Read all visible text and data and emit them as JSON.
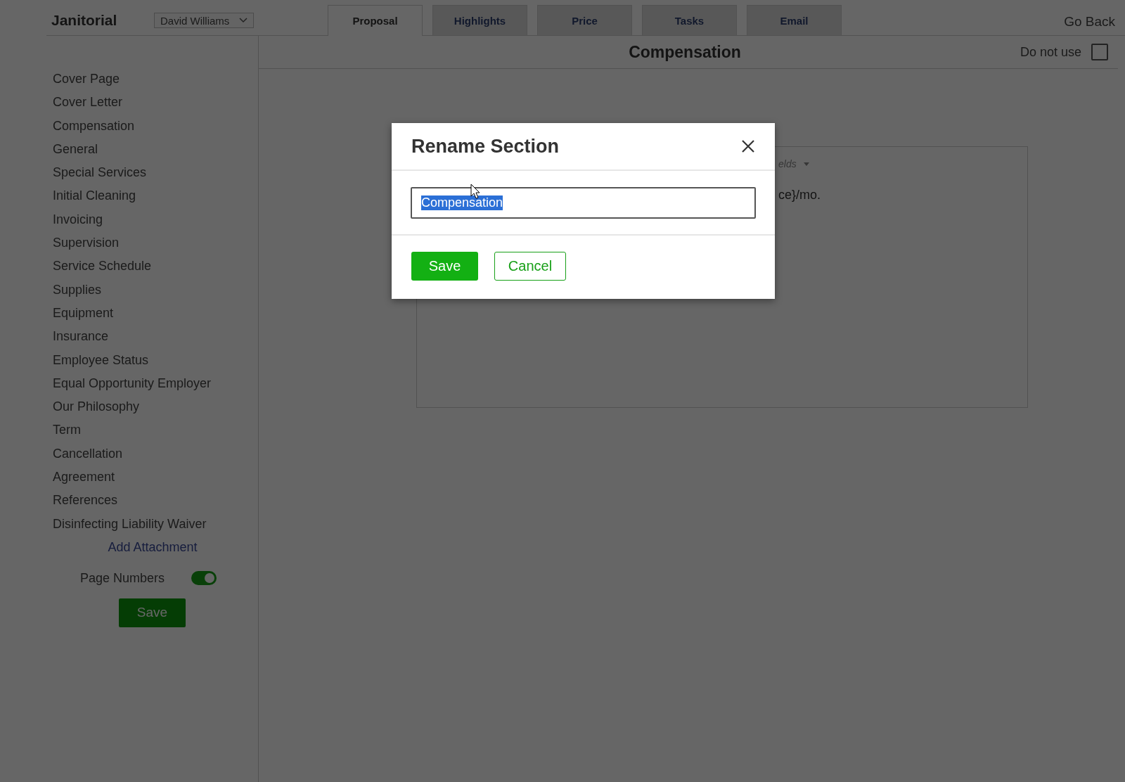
{
  "header": {
    "title": "Janitorial",
    "user_select": "David Williams",
    "go_back": "Go Back"
  },
  "tabs": [
    {
      "label": "Proposal",
      "selected": true
    },
    {
      "label": "Highlights",
      "selected": false
    },
    {
      "label": "Price",
      "selected": false
    },
    {
      "label": "Tasks",
      "selected": false
    },
    {
      "label": "Email",
      "selected": false
    }
  ],
  "sidebar": {
    "items": [
      {
        "label": "Cover Page"
      },
      {
        "label": "Cover Letter"
      },
      {
        "label": "Compensation"
      },
      {
        "label": "General"
      },
      {
        "label": "Special Services"
      },
      {
        "label": "Initial Cleaning"
      },
      {
        "label": "Invoicing"
      },
      {
        "label": "Supervision"
      },
      {
        "label": "Service Schedule"
      },
      {
        "label": "Supplies"
      },
      {
        "label": "Equipment"
      },
      {
        "label": "Insurance"
      },
      {
        "label": "Employee Status"
      },
      {
        "label": "Equal Opportunity Employer"
      },
      {
        "label": "Our Philosophy"
      },
      {
        "label": "Term"
      },
      {
        "label": "Cancellation"
      },
      {
        "label": "Agreement"
      },
      {
        "label": "References"
      },
      {
        "label": "Disinfecting Liability Waiver"
      }
    ],
    "add_attachment": "Add Attachment",
    "page_numbers": {
      "label": "Page Numbers",
      "on": true
    },
    "save": "Save"
  },
  "section": {
    "title": "Compensation",
    "do_not_use": {
      "label": "Do not use",
      "checked": false
    },
    "editor": {
      "toolbar_fragment": "elds",
      "text_fragment": "ce}/mo."
    }
  },
  "dialog": {
    "title": "Rename Section",
    "value": "Compensation",
    "buttons": [
      {
        "label": "Save",
        "kind": "primary"
      },
      {
        "label": "Cancel",
        "kind": "secondary"
      }
    ]
  }
}
